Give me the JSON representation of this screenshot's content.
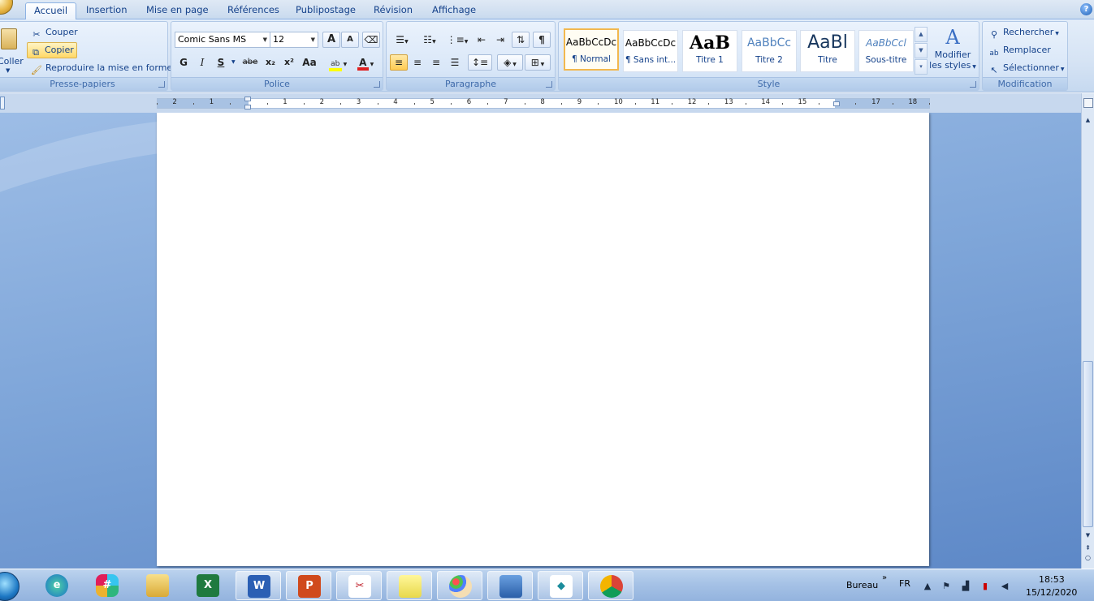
{
  "tabs": [
    "Accueil",
    "Insertion",
    "Mise en page",
    "Références",
    "Publipostage",
    "Révision",
    "Affichage"
  ],
  "help_label": "?",
  "clipboard": {
    "paste_label": "Coller",
    "cut_label": "Couper",
    "copy_label": "Copier",
    "format_painter_label": "Reproduire la mise en forme",
    "group_label": "Presse-papiers"
  },
  "font": {
    "family": "Comic Sans MS",
    "size": "12",
    "group_label": "Police",
    "bold": "G",
    "italic": "I",
    "underline": "S",
    "strike": "abe",
    "subscript": "x₂",
    "superscript": "x²",
    "change_case": "Aa",
    "grow": "A",
    "shrink": "A"
  },
  "paragraph": {
    "group_label": "Paragraphe",
    "pilcrow": "¶"
  },
  "styles": {
    "group_label": "Style",
    "items": [
      {
        "sample": "AaBbCcDc",
        "name": "¶ Normal"
      },
      {
        "sample": "AaBbCcDc",
        "name": "¶ Sans int..."
      },
      {
        "sample": "AaB",
        "name": "Titre 1"
      },
      {
        "sample": "AaBbCc",
        "name": "Titre 2"
      },
      {
        "sample": "AaBl",
        "name": "Titre"
      },
      {
        "sample": "AaBbCcl",
        "name": "Sous-titre"
      }
    ],
    "modify_label_1": "Modifier",
    "modify_label_2": "les styles"
  },
  "editing": {
    "group_label": "Modification",
    "find": "Rechercher",
    "replace": "Remplacer",
    "select": "Sélectionner"
  },
  "ruler_numbers": [
    "2",
    "1",
    "1",
    "2",
    "3",
    "4",
    "5",
    "6",
    "7",
    "8",
    "9",
    "10",
    "11",
    "12",
    "13",
    "14",
    "15",
    "17",
    "18"
  ],
  "taskbar": {
    "location_label": "Bureau",
    "language": "FR",
    "time": "18:53",
    "date": "15/12/2020"
  },
  "colors": {
    "accent": "#15428b",
    "highlight": "#ffd867",
    "ribbon": "#d5e3f4"
  }
}
